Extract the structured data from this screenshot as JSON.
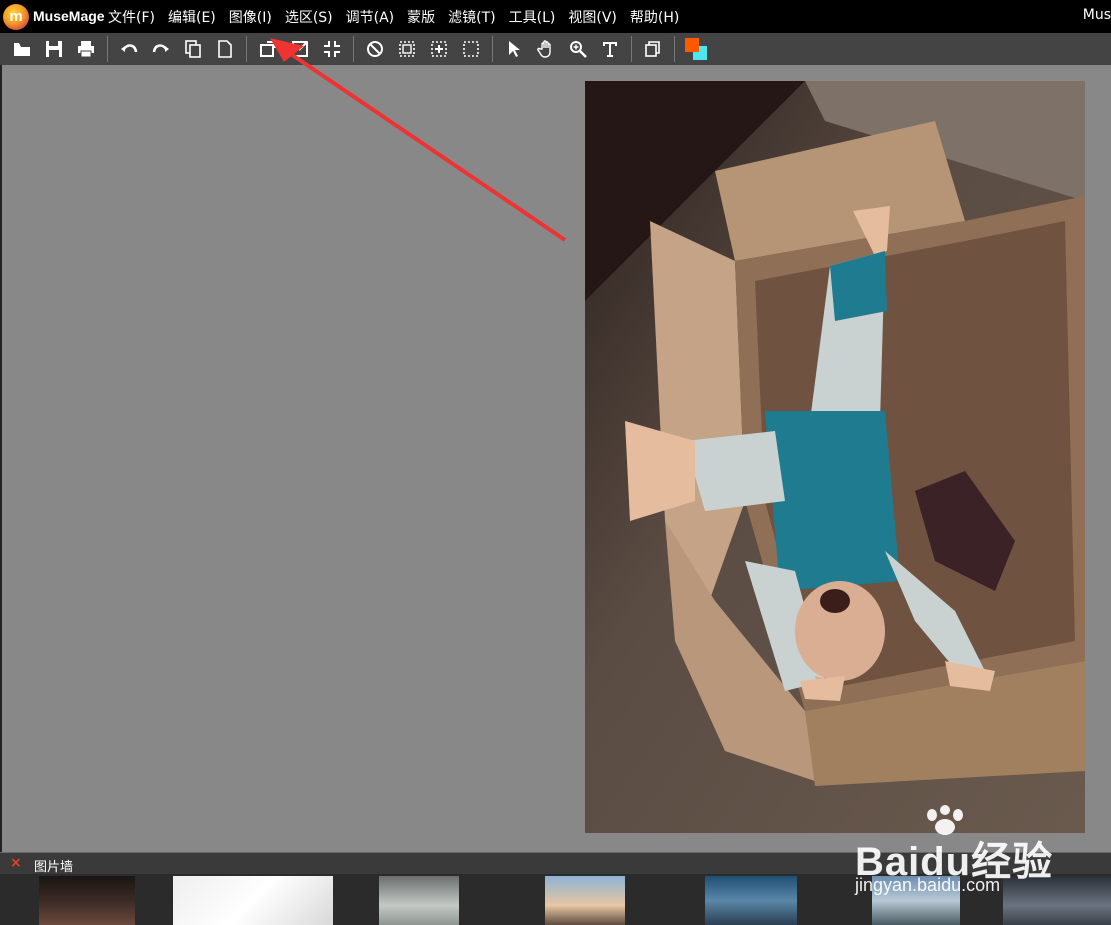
{
  "app": {
    "logo_letter": "m",
    "name": "MuseMage",
    "title_right": "Mus"
  },
  "menu": [
    {
      "label": "文件(F)"
    },
    {
      "label": "编辑(E)"
    },
    {
      "label": "图像(I)"
    },
    {
      "label": "选区(S)"
    },
    {
      "label": "调节(A)"
    },
    {
      "label": "蒙版"
    },
    {
      "label": "滤镜(T)"
    },
    {
      "label": "工具(L)"
    },
    {
      "label": "视图(V)"
    },
    {
      "label": "帮助(H)"
    }
  ],
  "toolbar": {
    "icons": [
      "open-icon",
      "save-icon",
      "print-icon",
      "undo-icon",
      "redo-icon",
      "copy-icon",
      "new-icon",
      "rotate-icon",
      "crop-icon",
      "fit-icon",
      "deselect-icon",
      "select-rect-icon",
      "select-center-icon",
      "select-all-icon",
      "pointer-icon",
      "hand-icon",
      "zoom-icon",
      "text-icon",
      "layers-icon"
    ],
    "foreground_color": "#ff5a00",
    "background_color": "#4fe7ef"
  },
  "picture_wall": {
    "close_label": "×",
    "title": "图片墙"
  },
  "watermark": {
    "brand": "Baidu经验",
    "url": "jingyan.baidu.com"
  },
  "colors": {
    "workspace": "#888888",
    "toolbar": "#444444",
    "arrow": "#ee3333"
  }
}
